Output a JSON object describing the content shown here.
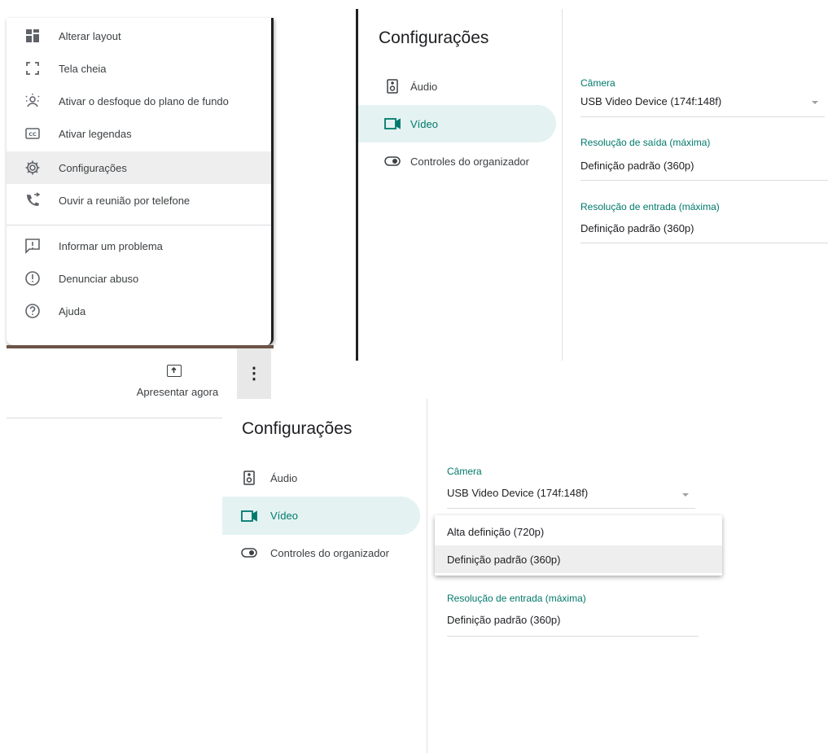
{
  "menu": {
    "items": [
      {
        "icon": "layout-icon",
        "label": "Alterar layout"
      },
      {
        "icon": "fullscreen-icon",
        "label": "Tela cheia"
      },
      {
        "icon": "background-blur-icon",
        "label": "Ativar o desfoque do plano de fundo"
      },
      {
        "icon": "captions-icon",
        "label": "Ativar legendas"
      },
      {
        "icon": "gear-icon",
        "label": "Configurações"
      },
      {
        "icon": "phone-audio-icon",
        "label": "Ouvir a reunião por telefone"
      },
      {
        "icon": "report-problem-icon",
        "label": "Informar um problema"
      },
      {
        "icon": "report-abuse-icon",
        "label": "Denunciar abuso"
      },
      {
        "icon": "help-icon",
        "label": "Ajuda"
      }
    ],
    "active_index": 4
  },
  "bottom_bar": {
    "present_label": "Apresentar agora",
    "more_label": "⋮"
  },
  "settings": {
    "title": "Configurações",
    "nav": [
      {
        "icon": "speaker-icon",
        "label": "Áudio"
      },
      {
        "icon": "video-icon",
        "label": "Vídeo"
      },
      {
        "icon": "toggle-icon",
        "label": "Controles do organizador"
      }
    ],
    "active_nav": 1,
    "camera_label": "Câmera",
    "camera_value": "USB Video Device (174f:148f)",
    "output_res_label": "Resolução de saída (máxima)",
    "output_res_value": "Definição padrão (360p)",
    "input_res_label": "Resolução de entrada (máxima)",
    "input_res_value": "Definição padrão (360p)"
  },
  "resolution_dropdown": {
    "options": [
      "Alta definição (720p)",
      "Definição padrão (360p)"
    ],
    "selected_index": 1
  },
  "colors": {
    "accent": "#00796b",
    "active_nav_bg": "#e4f2f2",
    "menu_hover_bg": "#eeeeee"
  }
}
